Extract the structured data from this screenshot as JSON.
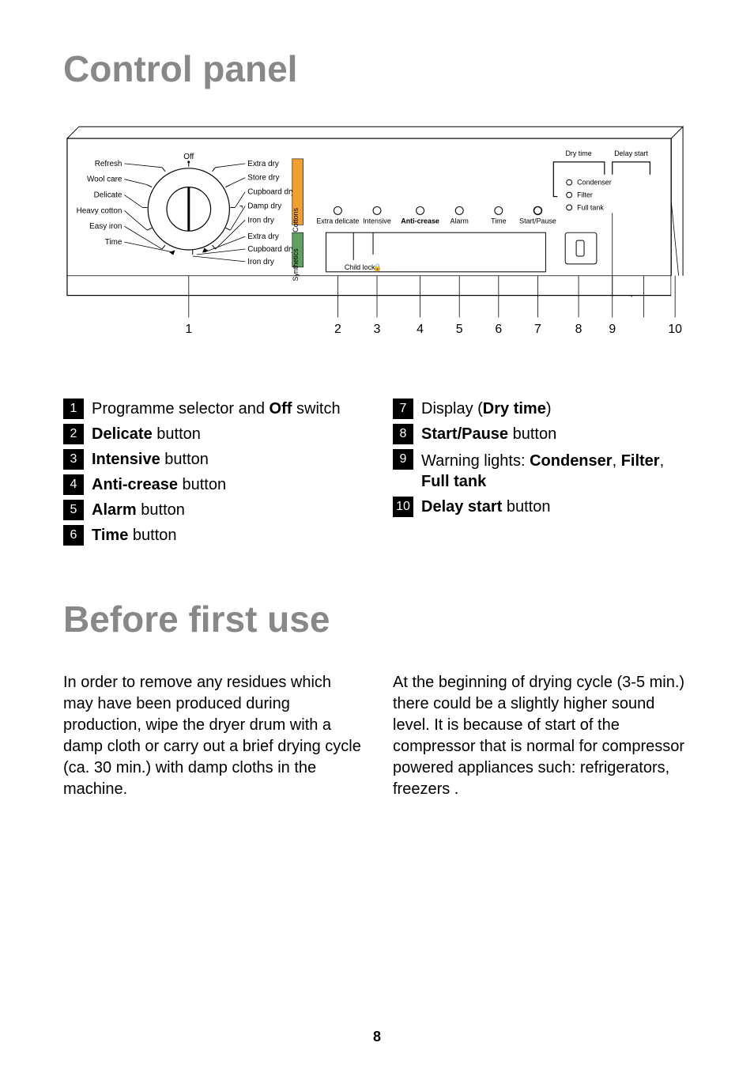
{
  "page_number": "8",
  "section1": {
    "title": "Control panel"
  },
  "section2": {
    "title": "Before first use"
  },
  "panel": {
    "dial": {
      "off": "Off",
      "left": [
        "Refresh",
        "Wool care",
        "Delicate",
        "Heavy cotton",
        "Easy iron",
        "Time"
      ],
      "right_cottons": [
        "Extra dry",
        "Store dry",
        "Cupboard dry",
        "Damp dry",
        "Iron dry"
      ],
      "right_synth": [
        "Extra dry",
        "Cupboard dry",
        "Iron dry"
      ],
      "group_cottons": "Cottons",
      "group_synth": "Synthetics"
    },
    "buttons": [
      "Extra delicate",
      "Intensive",
      "Anti-crease",
      "Alarm",
      "Time",
      "Start/Pause"
    ],
    "child_lock": "Child lock",
    "display_labels": {
      "dry_time": "Dry time",
      "delay_start": "Delay start"
    },
    "warning_lights": [
      "Condenser",
      "Filter",
      "Full tank"
    ],
    "callouts": [
      "1",
      "2",
      "3",
      "4",
      "5",
      "6",
      "7",
      "8",
      "9",
      "10"
    ]
  },
  "legend": {
    "left": [
      {
        "n": "1",
        "html": "Programme selector and <b>Off</b> switch"
      },
      {
        "n": "2",
        "html": "<b>Delicate</b> button"
      },
      {
        "n": "3",
        "html": "<b>Intensive</b> button"
      },
      {
        "n": "4",
        "html": "<b>Anti-crease</b> button"
      },
      {
        "n": "5",
        "html": "<b>Alarm</b> button"
      },
      {
        "n": "6",
        "html": "<b>Time</b> button"
      }
    ],
    "right": [
      {
        "n": "7",
        "html": "Display (<b>Dry time</b>)"
      },
      {
        "n": "8",
        "html": "<b>Start/Pause</b> button"
      },
      {
        "n": "9",
        "html": "Warning lights: <b>Condenser</b>, <b>Filter</b>, <b>Full tank</b>"
      },
      {
        "n": "10",
        "html": "<b>Delay start</b> button"
      }
    ]
  },
  "body": {
    "col1": "In order to remove any residues which may have been produced during production, wipe the dryer drum with a damp cloth or carry out a brief drying cycle (ca. 30 min.) with damp cloths in the machine.",
    "col2": "At the beginning of drying cycle (3-5 min.) there could be a slightly higher sound level. It is because of start of the compressor that is normal for compressor powered appliances such: refrigerators, freezers ."
  }
}
